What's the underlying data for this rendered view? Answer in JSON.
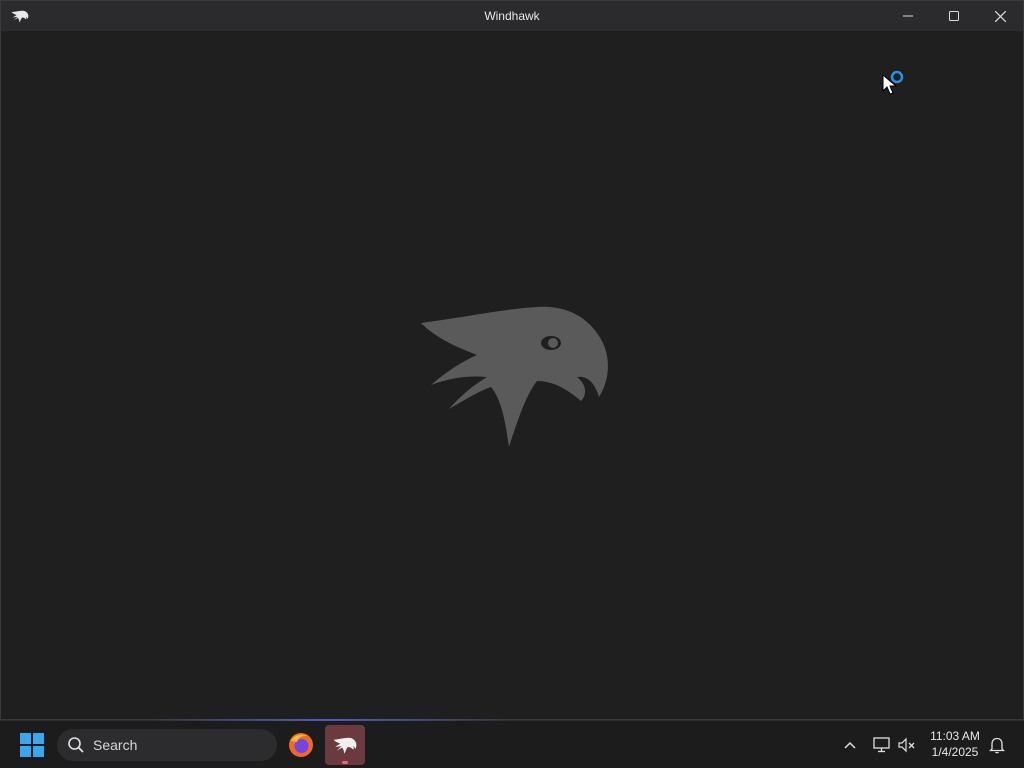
{
  "window": {
    "title": "Windhawk",
    "icon": "windhawk-eagle-icon",
    "controls": [
      "minimize-icon",
      "maximize-icon",
      "close-icon"
    ]
  },
  "splash": {
    "logo": "windhawk-eagle-logo",
    "logo_color": "#5a5a5a"
  },
  "cursor": {
    "type": "arrow-with-busy-ring",
    "ring_color": "#2f8fe8"
  },
  "taskbar": {
    "start_icon": "windows-logo-icon",
    "search_placeholder": "Search",
    "apps": [
      {
        "name": "Firefox",
        "icon": "firefox-icon",
        "active": false
      },
      {
        "name": "Windhawk",
        "icon": "windhawk-eagle-icon",
        "active": true
      }
    ],
    "tray": [
      "chevron-up-icon",
      "network-icon",
      "volume-muted-icon"
    ],
    "clock": {
      "time": "11:03 AM",
      "date": "1/4/2025"
    },
    "notification_icon": "bell-icon"
  },
  "colors": {
    "background": "#1f1f20",
    "titlebar": "#2b2b2d",
    "taskbar": "#1c1c1d",
    "windows_blue": "#3ba6ef",
    "active_app_bg": "#6b3a3e"
  }
}
